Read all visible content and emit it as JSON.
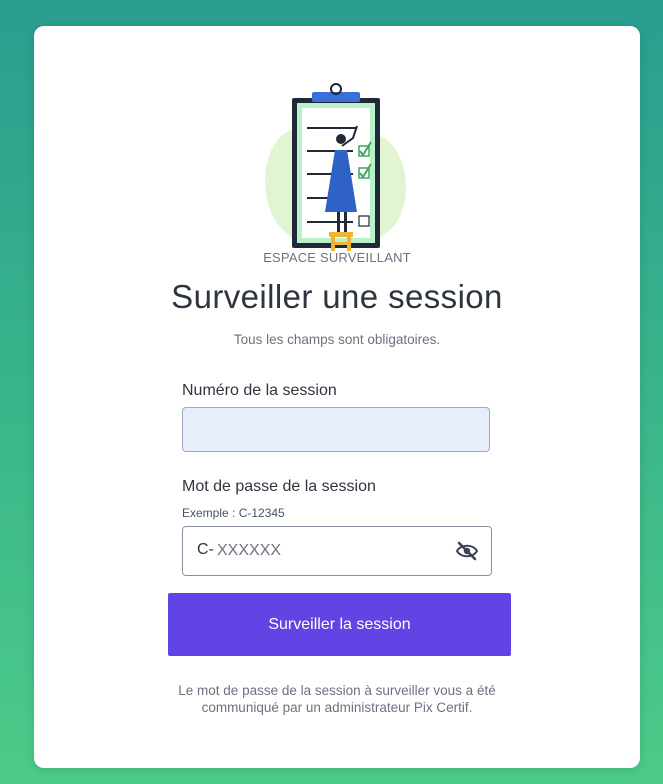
{
  "header": {
    "space_label": "ESPACE SURVEILLANT",
    "title": "Surveiller une session",
    "required_note": "Tous les champs sont obligatoires."
  },
  "form": {
    "session_number": {
      "label": "Numéro de la session",
      "value": ""
    },
    "session_password": {
      "label": "Mot de passe de la session",
      "hint": "Exemple : C-12345",
      "prefix": "C-",
      "placeholder": "XXXXXX",
      "value": "",
      "toggle_icon": "eye-slash-icon"
    },
    "submit_label": "Surveiller la session"
  },
  "footer": {
    "line1": "Le mot de passe de la session à surveiller vous a été",
    "line2": "communiqué par un administrateur Pix Certif."
  },
  "colors": {
    "primary_button": "#6244e5",
    "input_background": "#e6edfb",
    "background_top": "#2a9d8f",
    "background_bottom": "#4ccb88",
    "illustration_blob": "#e2f5d3",
    "clipboard_frame": "#1f2937",
    "clipboard_clip": "#3b6fd8",
    "dress": "#2f62c6",
    "check": "#43a75d",
    "stool": "#f2b233"
  }
}
